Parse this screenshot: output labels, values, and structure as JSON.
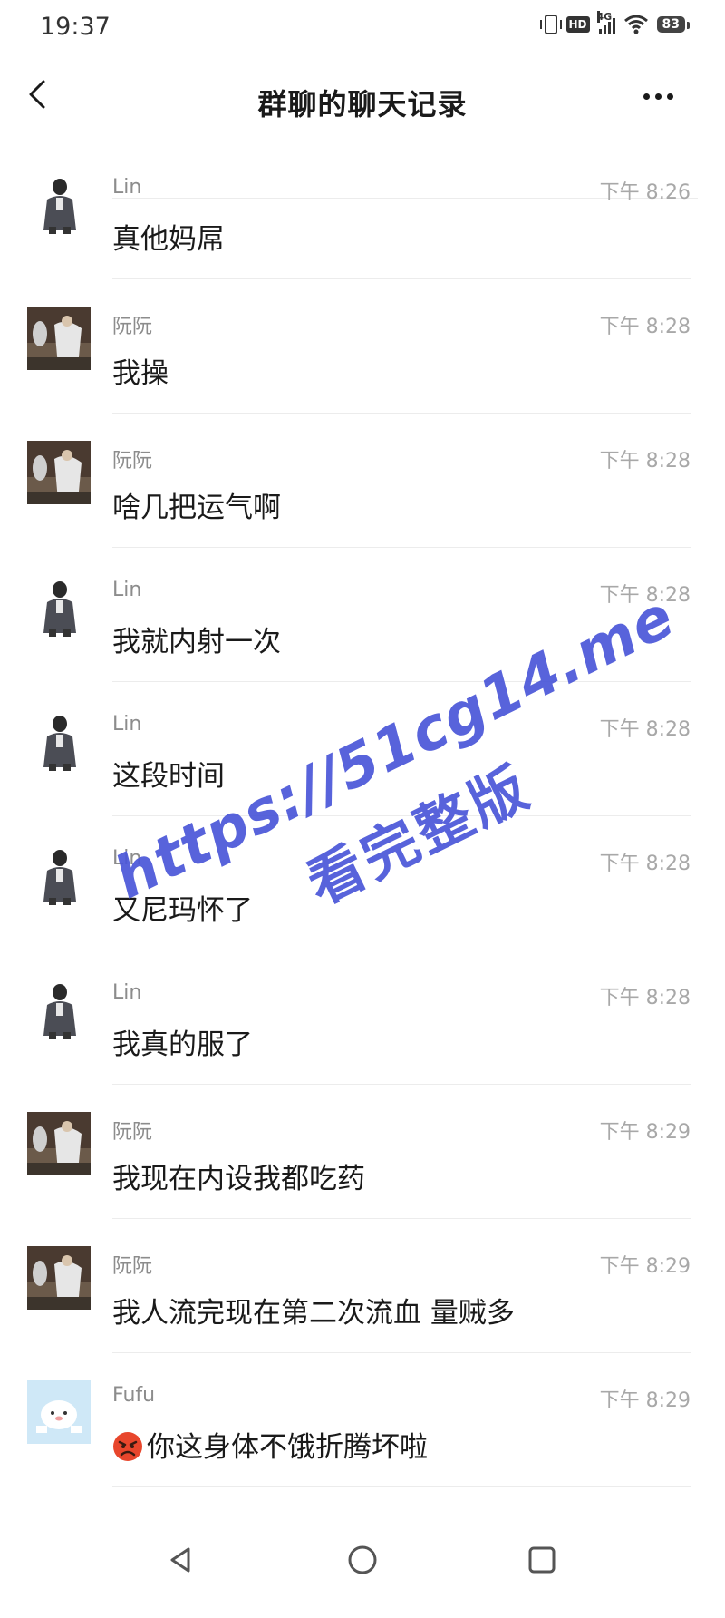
{
  "status_bar": {
    "time": "19:37",
    "hd_label": "HD",
    "network_label": "4G",
    "battery": "83"
  },
  "header": {
    "title": "群聊的聊天记录"
  },
  "messages": [
    {
      "sender": "Lin",
      "time": "下午 8:26",
      "text": "真他妈屌",
      "avatar": "lin-avatar"
    },
    {
      "sender": "阮阮",
      "time": "下午 8:28",
      "text": "我操",
      "avatar": "ruanruan-avatar"
    },
    {
      "sender": "阮阮",
      "time": "下午 8:28",
      "text": "啥几把运气啊",
      "avatar": "ruanruan-avatar"
    },
    {
      "sender": "Lin",
      "time": "下午 8:28",
      "text": "我就内射一次",
      "avatar": "lin-avatar"
    },
    {
      "sender": "Lin",
      "time": "下午 8:28",
      "text": "这段时间",
      "avatar": "lin-avatar"
    },
    {
      "sender": "Lin",
      "time": "下午 8:28",
      "text": "又尼玛怀了",
      "avatar": "lin-avatar"
    },
    {
      "sender": "Lin",
      "time": "下午 8:28",
      "text": "我真的服了",
      "avatar": "lin-avatar"
    },
    {
      "sender": "阮阮",
      "time": "下午 8:29",
      "text": "我现在内设我都吃药",
      "avatar": "ruanruan-avatar"
    },
    {
      "sender": "阮阮",
      "time": "下午 8:29",
      "text": "我人流完现在第二次流血 量贼多",
      "avatar": "ruanruan-avatar"
    },
    {
      "sender": "Fufu",
      "time": "下午 8:29",
      "text": "你这身体不饿折腾坏啦",
      "avatar": "fufu-avatar",
      "emoji": "angry-face-icon"
    }
  ],
  "watermark": {
    "line1": "https://51cg14.me",
    "line2": "看完整版",
    "color": "#4a56d8"
  },
  "nav_bar": {
    "icons": [
      "back-triangle-icon",
      "home-circle-icon",
      "recents-square-icon"
    ]
  }
}
